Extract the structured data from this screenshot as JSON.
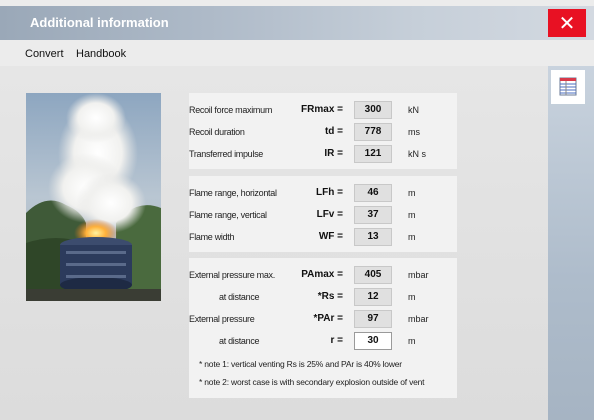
{
  "window": {
    "title": "Additional information",
    "close_glyph": "✕"
  },
  "menu": {
    "items": [
      "Convert",
      "Handbook"
    ]
  },
  "side_button": {
    "icon": "table-icon"
  },
  "colors": {
    "close": "#e81123",
    "titlebar": "#aebac8"
  },
  "recoil": {
    "rows": [
      {
        "label": "Recoil force maximum",
        "symbol": "FRmax =",
        "value": "300",
        "unit": "kN"
      },
      {
        "label": "Recoil duration",
        "symbol": "td =",
        "value": "778",
        "unit": "ms"
      },
      {
        "label": "Transferred impulse",
        "symbol": "IR =",
        "value": "121",
        "unit": "kN s"
      }
    ]
  },
  "flame": {
    "rows": [
      {
        "label": "Flame range, horizontal",
        "symbol": "LFh =",
        "value": "46",
        "unit": "m"
      },
      {
        "label": "Flame range, vertical",
        "symbol": "LFv =",
        "value": "37",
        "unit": "m"
      },
      {
        "label": "Flame width",
        "symbol": "WF =",
        "value": "13",
        "unit": "m"
      }
    ]
  },
  "pressure": {
    "rows": [
      {
        "label": "External pressure  max.",
        "symbol": "PAmax =",
        "value": "405",
        "unit": "mbar"
      },
      {
        "label": "at distance",
        "symbol": "*Rs =",
        "value": "12",
        "unit": "m"
      },
      {
        "label": "External pressure",
        "symbol": "*PAr =",
        "value": "97",
        "unit": "mbar"
      },
      {
        "label": "at distance",
        "symbol": "r =",
        "value": "30",
        "unit": "m"
      }
    ],
    "note1": "* note 1:  vertical venting Rs is 25% and PAr is 40% lower",
    "note2": "* note 2:  worst case is with secondary explosion outside of vent"
  }
}
